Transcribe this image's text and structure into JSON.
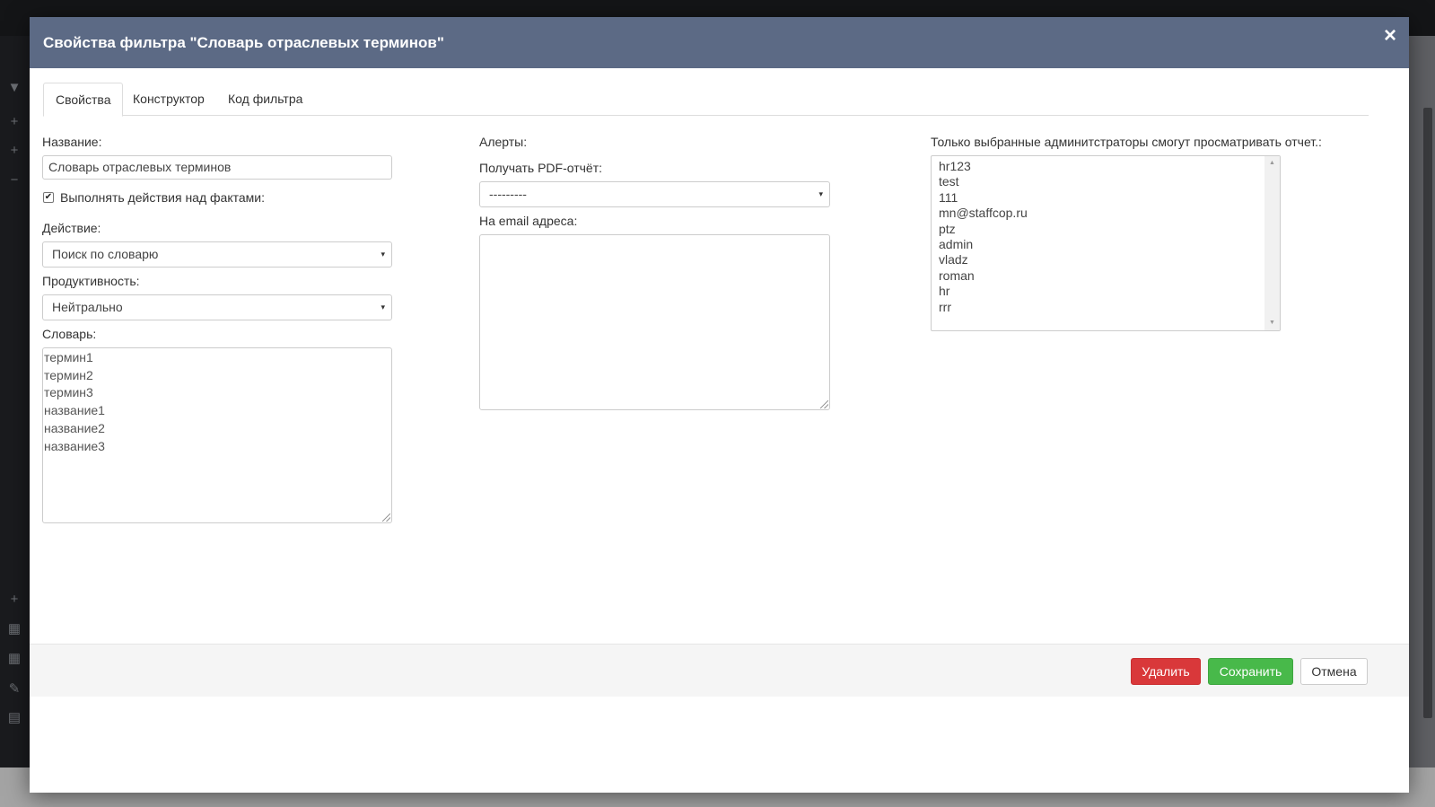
{
  "modal": {
    "title": "Свойства фильтра \"Словарь отраслевых терминов\"",
    "close": "×"
  },
  "tabs": [
    {
      "label": "Свойства",
      "active": true
    },
    {
      "label": "Конструктор",
      "active": false
    },
    {
      "label": "Код фильтра",
      "active": false
    }
  ],
  "left": {
    "name_label": "Название:",
    "name_value": "Словарь отраслевых терминов",
    "act_checkbox_label": "Выполнять действия над фактами:",
    "act_checkbox_checked": true,
    "action_label": "Действие:",
    "action_value": "Поиск по словарю",
    "productivity_label": "Продуктивность:",
    "productivity_value": "Нейтрально",
    "dictionary_label": "Словарь:",
    "dictionary_lines": [
      "термин1",
      "термин2",
      "термин3",
      "название1",
      "название2",
      "название3"
    ]
  },
  "middle": {
    "alerts_label": "Алерты:",
    "pdf_label": "Получать PDF-отчёт:",
    "pdf_value": "---------",
    "email_label": "На email адреса:",
    "email_value": ""
  },
  "right": {
    "admins_label": "Только выбранные админитстраторы смогут просматривать отчет.:",
    "admins": [
      "hr123",
      "test",
      "111",
      "mn@staffcop.ru",
      "ptz",
      "admin",
      "vladz",
      "roman",
      "hr",
      "rrr"
    ]
  },
  "footer": {
    "delete_label": "Удалить",
    "save_label": "Сохранить",
    "cancel_label": "Отмена"
  },
  "icons": {
    "select_arrow": "▾",
    "checkmark": "✔",
    "scroll_up": "▲",
    "scroll_down": "▼"
  },
  "colors": {
    "header_bg": "#5c6a85",
    "danger": "#d9383a",
    "success": "#48b94a"
  }
}
